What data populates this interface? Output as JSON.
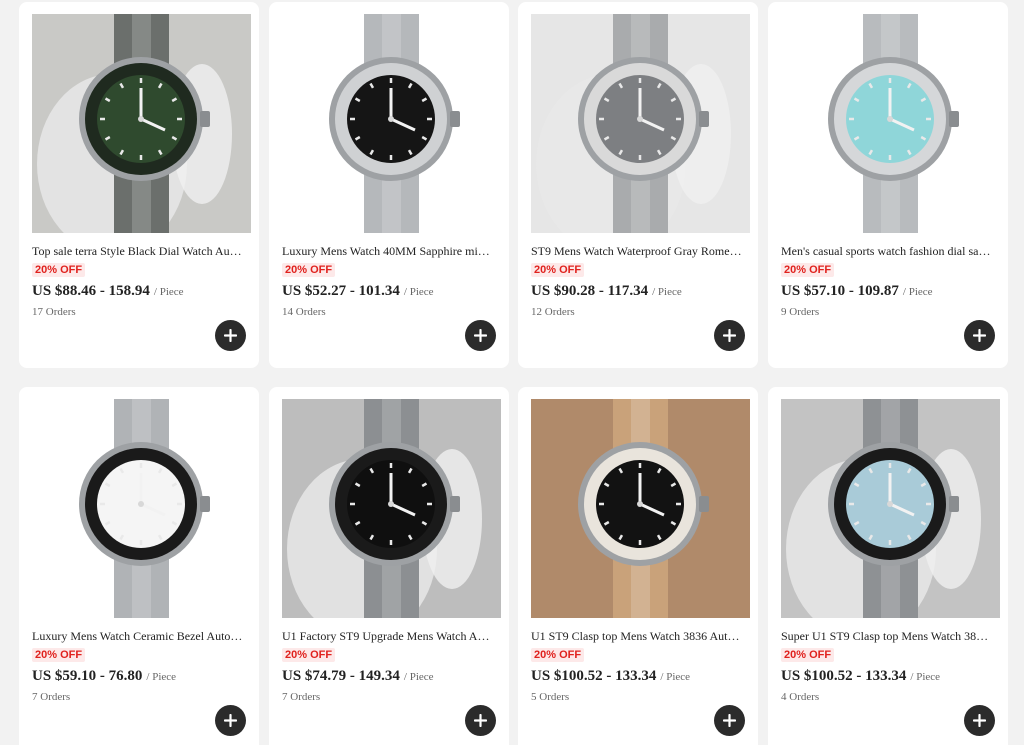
{
  "products": [
    {
      "title": "Top sale terra Style Black Dial Watch Au…",
      "discount": "20% OFF",
      "price": "US $88.46 - 158.94",
      "unit": "/ Piece",
      "orders": "17 Orders"
    },
    {
      "title": "Luxury Mens Watch 40MM Sapphire mi…",
      "discount": "20% OFF",
      "price": "US $52.27 - 101.34",
      "unit": "/ Piece",
      "orders": "14 Orders"
    },
    {
      "title": "ST9 Mens Watch Waterproof Gray Rome…",
      "discount": "20% OFF",
      "price": "US $90.28 - 117.34",
      "unit": "/ Piece",
      "orders": "12 Orders"
    },
    {
      "title": "Men's casual sports watch fashion dial sa…",
      "discount": "20% OFF",
      "price": "US $57.10 - 109.87",
      "unit": "/ Piece",
      "orders": "9 Orders"
    },
    {
      "title": "Luxury Mens Watch Ceramic Bezel Auto…",
      "discount": "20% OFF",
      "price": "US $59.10 - 76.80",
      "unit": "/ Piece",
      "orders": "7 Orders"
    },
    {
      "title": "U1 Factory ST9 Upgrade Mens Watch A…",
      "discount": "20% OFF",
      "price": "US $74.79 - 149.34",
      "unit": "/ Piece",
      "orders": "7 Orders"
    },
    {
      "title": "U1 ST9 Clasp top Mens Watch 3836 Aut…",
      "discount": "20% OFF",
      "price": "US $100.52 - 133.34",
      "unit": "/ Piece",
      "orders": "5 Orders"
    },
    {
      "title": "Super U1 ST9 Clasp top Mens Watch 38…",
      "discount": "20% OFF",
      "price": "US $100.52 - 133.34",
      "unit": "/ Piece",
      "orders": "4 Orders"
    }
  ],
  "images": [
    {
      "icon": "watch-green-dial-mesh-strap-image",
      "background": "#c9c9c6",
      "dial": "#2f4a2e",
      "bezel": "#1f2a1f",
      "band": "#6b6f6c",
      "has_hand": true
    },
    {
      "icon": "watch-black-dial-steel-image",
      "background": "#ffffff",
      "dial": "#151515",
      "bezel": "#cfd1d3",
      "band": "#b5b8bb",
      "has_hand": false
    },
    {
      "icon": "watch-gray-dial-fluted-bezel-image",
      "background": "#e6e6e6",
      "dial": "#7d7f82",
      "bezel": "#d9d9d9",
      "band": "#a9abad",
      "has_hand": true
    },
    {
      "icon": "watch-colorful-dial-image",
      "background": "#ffffff",
      "dial": "#8fd6d9",
      "bezel": "#d5d7d9",
      "band": "#b8bbbe",
      "has_hand": false
    },
    {
      "icon": "watch-white-chronograph-image",
      "background": "#ffffff",
      "dial": "#f5f5f5",
      "bezel": "#1a1a1a",
      "band": "#b0b3b6",
      "has_hand": false
    },
    {
      "icon": "watch-black-diver-image",
      "background": "#bdbdbd",
      "dial": "#0f0f0f",
      "bezel": "#1a1a1a",
      "band": "#8c8f92",
      "has_hand": true
    },
    {
      "icon": "watch-two-tone-chronograph-on-wrist-image",
      "background": "#b08a6a",
      "dial": "#121212",
      "bezel": "#e9e4dc",
      "band": "#c9a27a",
      "has_hand": false
    },
    {
      "icon": "watch-ice-blue-chronograph-image",
      "background": "#c3c3c3",
      "dial": "#a9cbd8",
      "bezel": "#1a1a1a",
      "band": "#8e9194",
      "has_hand": true
    }
  ]
}
